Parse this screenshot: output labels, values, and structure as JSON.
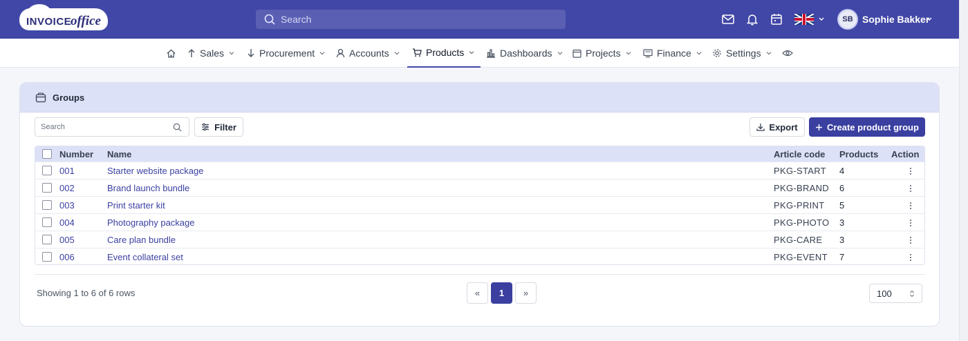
{
  "brand": {
    "logo_text_1": "INVOICE",
    "logo_text_2": "office"
  },
  "topbar": {
    "search_placeholder": "Search",
    "user_initials": "SB",
    "user_name": "Sophie Bakker",
    "icons": [
      "mail-icon",
      "bell-icon",
      "calendar-icon",
      "uk-flag-icon"
    ]
  },
  "nav": {
    "items": [
      {
        "label": "Sales",
        "icon": "arrow-up-icon"
      },
      {
        "label": "Procurement",
        "icon": "arrow-down-icon"
      },
      {
        "label": "Accounts",
        "icon": "user-icon"
      },
      {
        "label": "Products",
        "icon": "cart-icon",
        "active": true
      },
      {
        "label": "Dashboards",
        "icon": "bar-chart-icon"
      },
      {
        "label": "Projects",
        "icon": "calendar-icon"
      },
      {
        "label": "Finance",
        "icon": "monitor-icon"
      },
      {
        "label": "Settings",
        "icon": "gear-icon"
      }
    ]
  },
  "card": {
    "title": "Groups",
    "search_placeholder": "Search",
    "filter_label": "Filter",
    "export_label": "Export",
    "create_label": "Create product group"
  },
  "table": {
    "columns": {
      "number": "Number",
      "name": "Name",
      "article_code": "Article code",
      "products": "Products",
      "action": "Action"
    },
    "rows": [
      {
        "number": "001",
        "name": "Starter website package",
        "code": "PKG-START",
        "products": "4"
      },
      {
        "number": "002",
        "name": "Brand launch bundle",
        "code": "PKG-BRAND",
        "products": "6"
      },
      {
        "number": "003",
        "name": "Print starter kit",
        "code": "PKG-PRINT",
        "products": "5"
      },
      {
        "number": "004",
        "name": "Photography package",
        "code": "PKG-PHOTO",
        "products": "3"
      },
      {
        "number": "005",
        "name": "Care plan bundle",
        "code": "PKG-CARE",
        "products": "3"
      },
      {
        "number": "006",
        "name": "Event collateral set",
        "code": "PKG-EVENT",
        "products": "7"
      }
    ]
  },
  "footer": {
    "showing_text": "Showing 1 to 6 of 6 rows",
    "prev_label": "«",
    "current_page": "1",
    "next_label": "»",
    "page_size": "100"
  },
  "colors": {
    "primary": "#4147a6",
    "button": "#3a3fa0",
    "header_bg": "#dde1f7"
  }
}
